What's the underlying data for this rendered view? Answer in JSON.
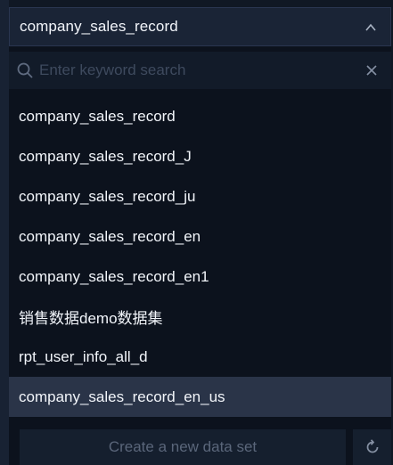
{
  "select": {
    "value": "company_sales_record",
    "expanded": true
  },
  "search": {
    "placeholder": "Enter keyword search",
    "value": ""
  },
  "options": [
    {
      "label": "company_sales_record",
      "selected": false
    },
    {
      "label": "company_sales_record_J",
      "selected": false
    },
    {
      "label": "company_sales_record_ju",
      "selected": false
    },
    {
      "label": "company_sales_record_en",
      "selected": false
    },
    {
      "label": "company_sales_record_en1",
      "selected": false
    },
    {
      "label": "销售数据demo数据集",
      "selected": false
    },
    {
      "label": "rpt_user_info_all_d",
      "selected": false
    },
    {
      "label": "company_sales_record_en_us",
      "selected": true
    }
  ],
  "footer": {
    "create_label": "Create a new data set"
  },
  "icons": {
    "chevron": "chevron-up-icon",
    "search": "search-icon",
    "clear": "close-icon",
    "refresh": "refresh-icon"
  },
  "colors": {
    "background": "#0c121d",
    "header": "#1a2436",
    "selected_row": "#2a3448",
    "text": "#f2f5fa",
    "muted": "#5a667a"
  }
}
